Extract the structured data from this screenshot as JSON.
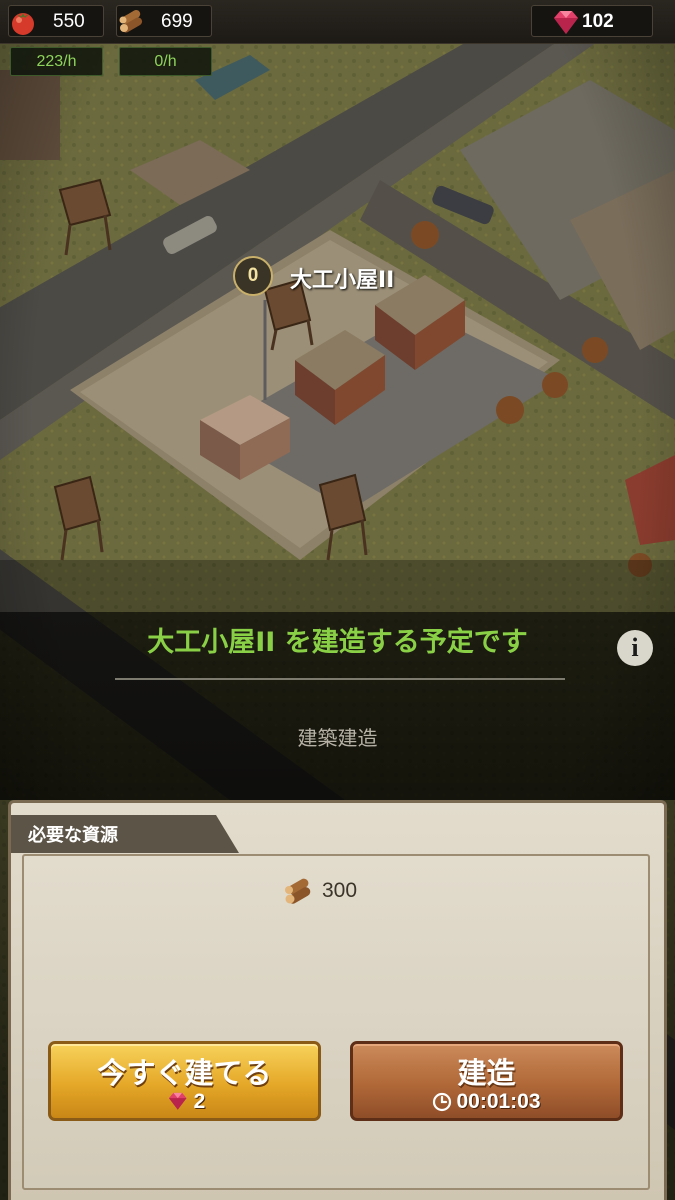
{
  "resources": {
    "food": {
      "icon": "tomato-icon",
      "value": "550",
      "rate": "223/h"
    },
    "wood": {
      "icon": "wood-logs-icon",
      "value": "699",
      "rate": "0/h"
    },
    "gems": {
      "icon": "ruby-gem-icon",
      "value": "102"
    }
  },
  "map": {
    "building_level": "0",
    "building_name": "大工小屋II"
  },
  "build_info": {
    "title": "大工小屋II を建造する予定です",
    "subtitle": "建築建造",
    "info_icon": "i"
  },
  "requirements": {
    "heading": "必要な資源",
    "items": [
      {
        "icon": "wood-logs-icon",
        "amount": "300"
      }
    ]
  },
  "actions": {
    "build_now": {
      "label": "今すぐ建てる",
      "cost": "2",
      "cost_icon": "ruby-gem-icon"
    },
    "build": {
      "label": "建造",
      "time": "00:01:03",
      "time_icon": "clock-icon"
    }
  },
  "colors": {
    "accent_green": "#8ad046",
    "gold_button": "#e5a828",
    "brown_button": "#b06838",
    "parchment": "#d7cfbd"
  }
}
